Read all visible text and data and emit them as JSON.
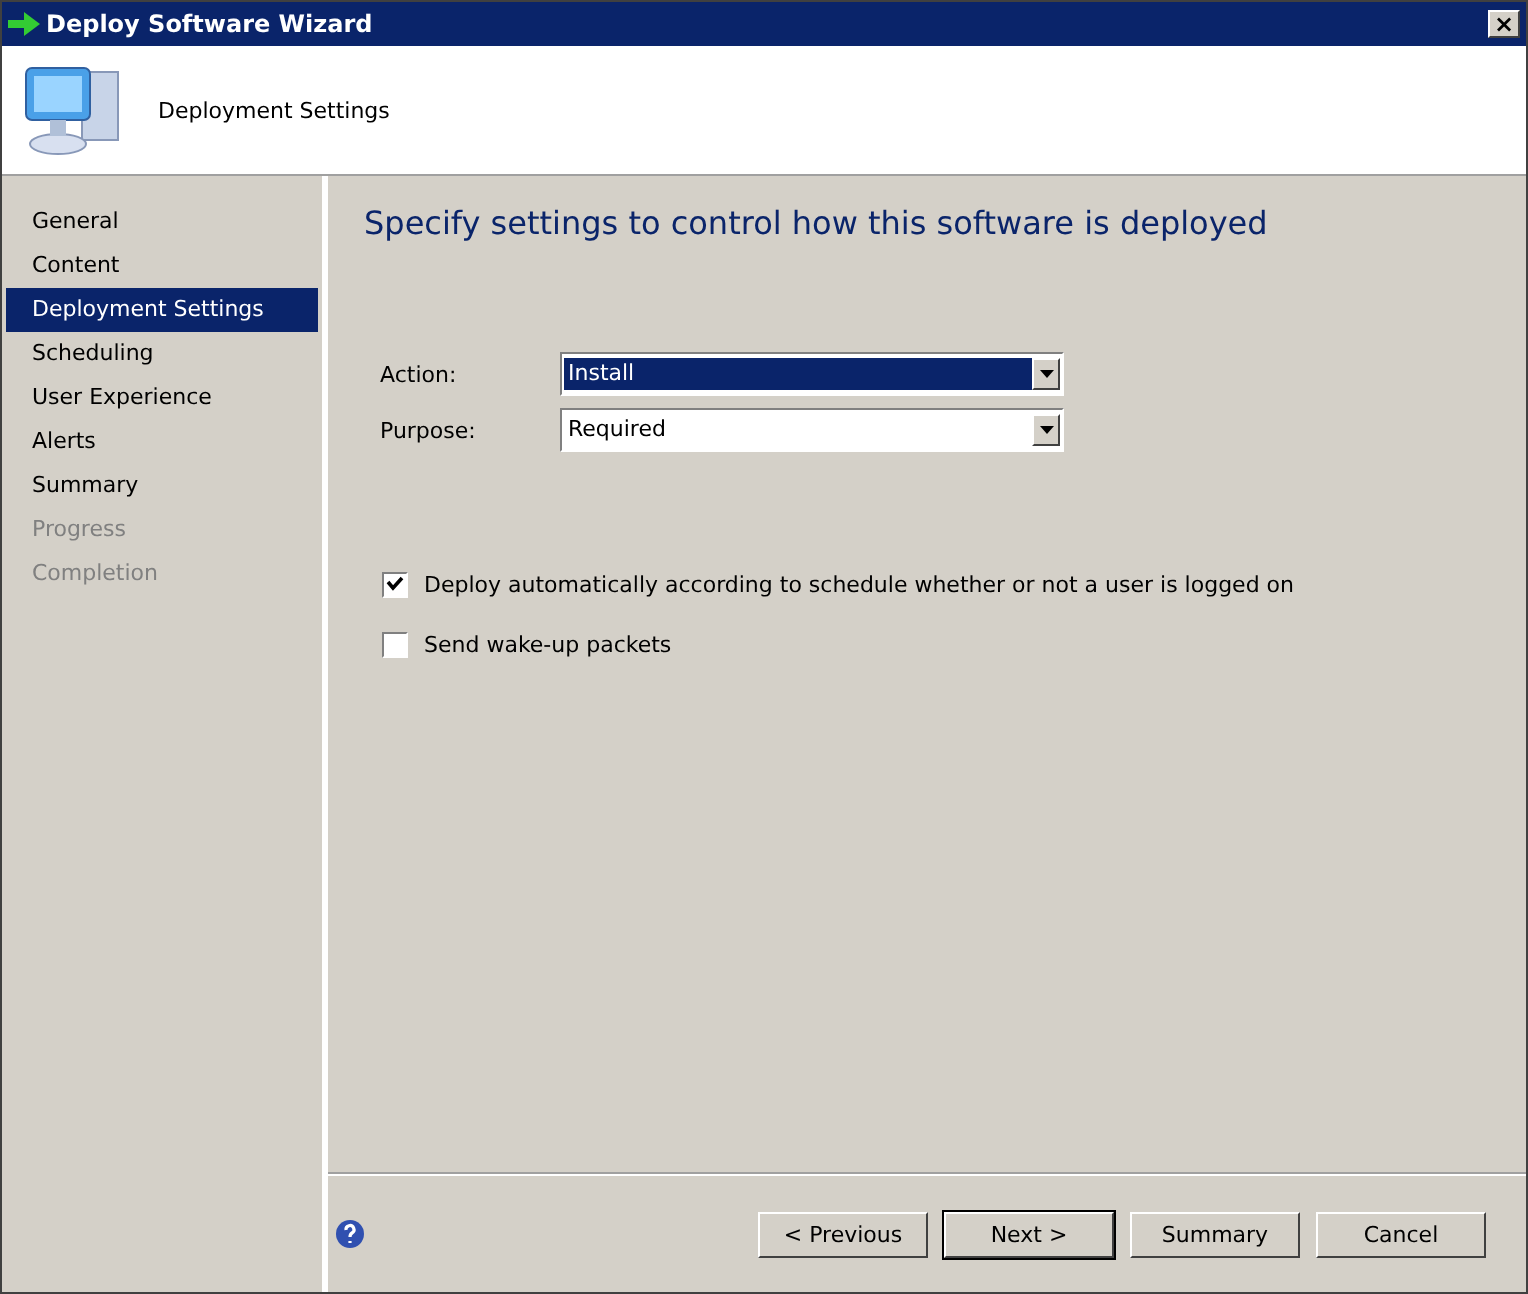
{
  "window": {
    "title": "Deploy Software Wizard",
    "close": "×"
  },
  "header": {
    "title": "Deployment Settings"
  },
  "sidebar": {
    "items": [
      {
        "label": "General",
        "selected": false,
        "disabled": false
      },
      {
        "label": "Content",
        "selected": false,
        "disabled": false
      },
      {
        "label": "Deployment Settings",
        "selected": true,
        "disabled": false
      },
      {
        "label": "Scheduling",
        "selected": false,
        "disabled": false
      },
      {
        "label": "User Experience",
        "selected": false,
        "disabled": false
      },
      {
        "label": "Alerts",
        "selected": false,
        "disabled": false
      },
      {
        "label": "Summary",
        "selected": false,
        "disabled": false
      },
      {
        "label": "Progress",
        "selected": false,
        "disabled": true
      },
      {
        "label": "Completion",
        "selected": false,
        "disabled": true
      }
    ]
  },
  "page": {
    "heading": "Specify settings to control how this software is deployed",
    "fields": [
      {
        "label": "Action:",
        "value": "Install",
        "focused": true
      },
      {
        "label": "Purpose:",
        "value": "Required",
        "focused": false
      }
    ],
    "options": [
      {
        "label": "Deploy automatically according to schedule whether or not a user is logged on",
        "checked": true
      },
      {
        "label": "Send wake-up packets",
        "checked": false
      }
    ]
  },
  "footer": {
    "buttons": [
      {
        "label": "< Previous",
        "default": false
      },
      {
        "label": "Next >",
        "default": true
      },
      {
        "label": "Summary",
        "default": false
      },
      {
        "label": "Cancel",
        "default": false
      }
    ]
  }
}
